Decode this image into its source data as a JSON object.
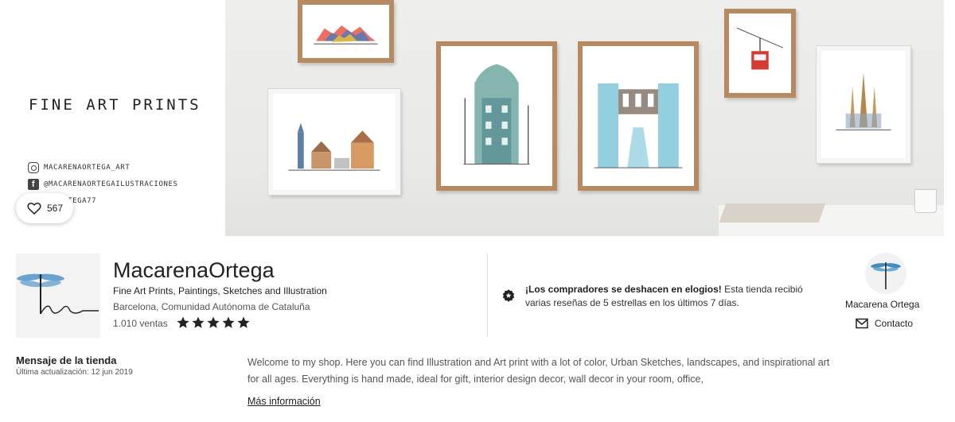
{
  "banner": {
    "title": "FINE ART PRINTS",
    "social": [
      {
        "icon": "instagram-icon",
        "handle": "MACARENAORTEGA_ART"
      },
      {
        "icon": "facebook-icon",
        "handle": "@MACARENAORTEGAILUSTRACIONES"
      },
      {
        "icon": "pinterest-icon",
        "handle": "ENAORTEGA77"
      }
    ],
    "favorites": {
      "icon": "heart-icon",
      "count": "567"
    }
  },
  "shop": {
    "name": "MacarenaOrtega",
    "tagline": "Fine Art Prints, Paintings, Sketches and Illustration",
    "location": "Barcelona, Comunidad Autónoma de Cataluña",
    "sales": "1.010 ventas",
    "rating": 5,
    "rating_max": 5
  },
  "praise": {
    "icon": "star-badge-icon",
    "bold": "¡Los compradores se deshacen en elogios!",
    "text": " Esta tienda recibió varias reseñas de 5 estrellas en los últimos 7 días."
  },
  "owner": {
    "name": "Macarena Ortega",
    "contact_label": "Contacto",
    "contact_icon": "envelope-icon"
  },
  "message": {
    "title": "Mensaje de la tienda",
    "updated": "Última actualización: 12 jun 2019",
    "body": "Welcome to my shop. Here you can find Illustration and Art print with a lot of color, Urban Sketches, landscapes, and inspirational art for all ages. Everything is hand made, ideal for gift, interior design decor, wall decor in your room, office,",
    "more": "Más información"
  },
  "colors": {
    "frame_wood": "#b88a62",
    "star": "#222222",
    "text": "#222222"
  }
}
